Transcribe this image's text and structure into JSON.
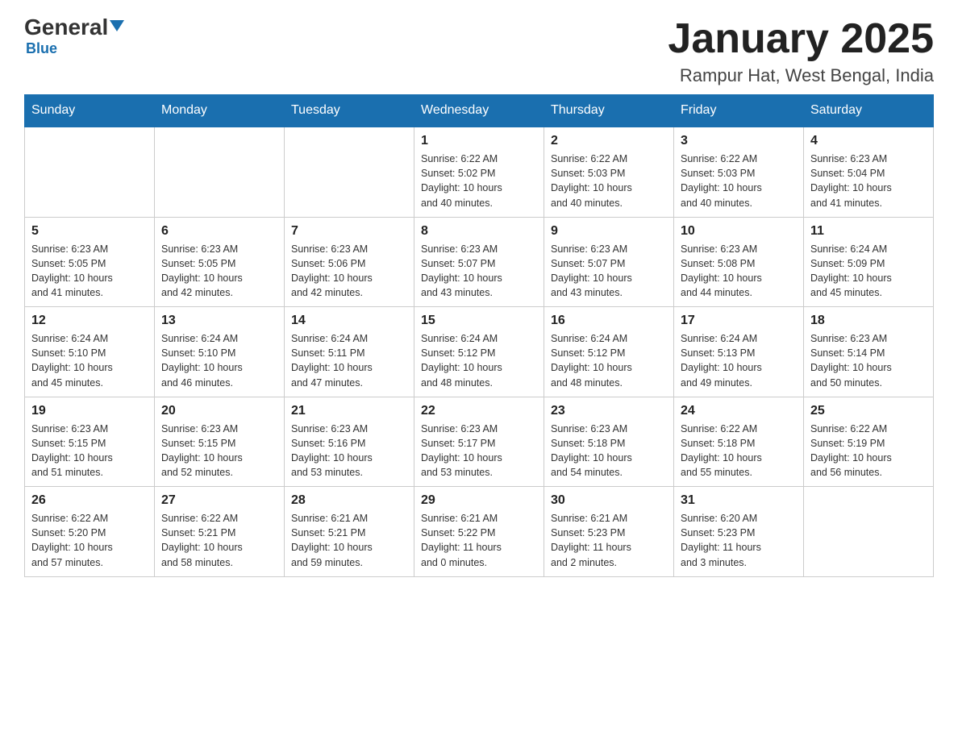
{
  "header": {
    "logo_main": "General",
    "logo_sub": "Blue",
    "month_title": "January 2025",
    "location": "Rampur Hat, West Bengal, India"
  },
  "weekdays": [
    "Sunday",
    "Monday",
    "Tuesday",
    "Wednesday",
    "Thursday",
    "Friday",
    "Saturday"
  ],
  "weeks": [
    [
      {
        "day": "",
        "info": ""
      },
      {
        "day": "",
        "info": ""
      },
      {
        "day": "",
        "info": ""
      },
      {
        "day": "1",
        "info": "Sunrise: 6:22 AM\nSunset: 5:02 PM\nDaylight: 10 hours\nand 40 minutes."
      },
      {
        "day": "2",
        "info": "Sunrise: 6:22 AM\nSunset: 5:03 PM\nDaylight: 10 hours\nand 40 minutes."
      },
      {
        "day": "3",
        "info": "Sunrise: 6:22 AM\nSunset: 5:03 PM\nDaylight: 10 hours\nand 40 minutes."
      },
      {
        "day": "4",
        "info": "Sunrise: 6:23 AM\nSunset: 5:04 PM\nDaylight: 10 hours\nand 41 minutes."
      }
    ],
    [
      {
        "day": "5",
        "info": "Sunrise: 6:23 AM\nSunset: 5:05 PM\nDaylight: 10 hours\nand 41 minutes."
      },
      {
        "day": "6",
        "info": "Sunrise: 6:23 AM\nSunset: 5:05 PM\nDaylight: 10 hours\nand 42 minutes."
      },
      {
        "day": "7",
        "info": "Sunrise: 6:23 AM\nSunset: 5:06 PM\nDaylight: 10 hours\nand 42 minutes."
      },
      {
        "day": "8",
        "info": "Sunrise: 6:23 AM\nSunset: 5:07 PM\nDaylight: 10 hours\nand 43 minutes."
      },
      {
        "day": "9",
        "info": "Sunrise: 6:23 AM\nSunset: 5:07 PM\nDaylight: 10 hours\nand 43 minutes."
      },
      {
        "day": "10",
        "info": "Sunrise: 6:23 AM\nSunset: 5:08 PM\nDaylight: 10 hours\nand 44 minutes."
      },
      {
        "day": "11",
        "info": "Sunrise: 6:24 AM\nSunset: 5:09 PM\nDaylight: 10 hours\nand 45 minutes."
      }
    ],
    [
      {
        "day": "12",
        "info": "Sunrise: 6:24 AM\nSunset: 5:10 PM\nDaylight: 10 hours\nand 45 minutes."
      },
      {
        "day": "13",
        "info": "Sunrise: 6:24 AM\nSunset: 5:10 PM\nDaylight: 10 hours\nand 46 minutes."
      },
      {
        "day": "14",
        "info": "Sunrise: 6:24 AM\nSunset: 5:11 PM\nDaylight: 10 hours\nand 47 minutes."
      },
      {
        "day": "15",
        "info": "Sunrise: 6:24 AM\nSunset: 5:12 PM\nDaylight: 10 hours\nand 48 minutes."
      },
      {
        "day": "16",
        "info": "Sunrise: 6:24 AM\nSunset: 5:12 PM\nDaylight: 10 hours\nand 48 minutes."
      },
      {
        "day": "17",
        "info": "Sunrise: 6:24 AM\nSunset: 5:13 PM\nDaylight: 10 hours\nand 49 minutes."
      },
      {
        "day": "18",
        "info": "Sunrise: 6:23 AM\nSunset: 5:14 PM\nDaylight: 10 hours\nand 50 minutes."
      }
    ],
    [
      {
        "day": "19",
        "info": "Sunrise: 6:23 AM\nSunset: 5:15 PM\nDaylight: 10 hours\nand 51 minutes."
      },
      {
        "day": "20",
        "info": "Sunrise: 6:23 AM\nSunset: 5:15 PM\nDaylight: 10 hours\nand 52 minutes."
      },
      {
        "day": "21",
        "info": "Sunrise: 6:23 AM\nSunset: 5:16 PM\nDaylight: 10 hours\nand 53 minutes."
      },
      {
        "day": "22",
        "info": "Sunrise: 6:23 AM\nSunset: 5:17 PM\nDaylight: 10 hours\nand 53 minutes."
      },
      {
        "day": "23",
        "info": "Sunrise: 6:23 AM\nSunset: 5:18 PM\nDaylight: 10 hours\nand 54 minutes."
      },
      {
        "day": "24",
        "info": "Sunrise: 6:22 AM\nSunset: 5:18 PM\nDaylight: 10 hours\nand 55 minutes."
      },
      {
        "day": "25",
        "info": "Sunrise: 6:22 AM\nSunset: 5:19 PM\nDaylight: 10 hours\nand 56 minutes."
      }
    ],
    [
      {
        "day": "26",
        "info": "Sunrise: 6:22 AM\nSunset: 5:20 PM\nDaylight: 10 hours\nand 57 minutes."
      },
      {
        "day": "27",
        "info": "Sunrise: 6:22 AM\nSunset: 5:21 PM\nDaylight: 10 hours\nand 58 minutes."
      },
      {
        "day": "28",
        "info": "Sunrise: 6:21 AM\nSunset: 5:21 PM\nDaylight: 10 hours\nand 59 minutes."
      },
      {
        "day": "29",
        "info": "Sunrise: 6:21 AM\nSunset: 5:22 PM\nDaylight: 11 hours\nand 0 minutes."
      },
      {
        "day": "30",
        "info": "Sunrise: 6:21 AM\nSunset: 5:23 PM\nDaylight: 11 hours\nand 2 minutes."
      },
      {
        "day": "31",
        "info": "Sunrise: 6:20 AM\nSunset: 5:23 PM\nDaylight: 11 hours\nand 3 minutes."
      },
      {
        "day": "",
        "info": ""
      }
    ]
  ]
}
